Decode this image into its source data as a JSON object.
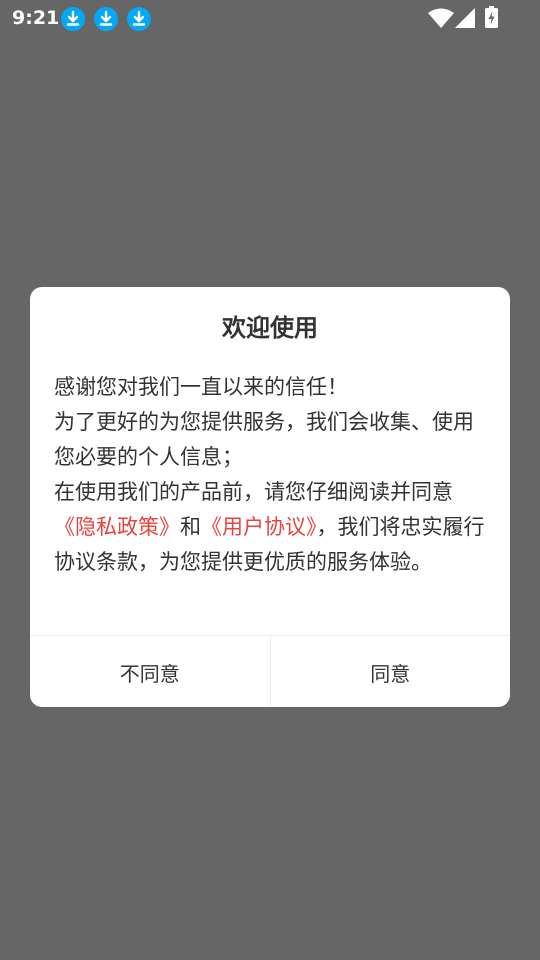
{
  "status_bar": {
    "time": "9:21",
    "download_icons": [
      "download-icon",
      "download-icon",
      "download-icon"
    ],
    "download_icon_color": "#03a9f4",
    "status_icons": [
      "wifi-icon",
      "cell-signal-icon",
      "battery-charging-icon"
    ]
  },
  "dialog": {
    "title": "欢迎使用",
    "body": {
      "line1": "感谢您对我们一直以来的信任！",
      "line2": "为了更好的为您提供服务，我们会收集、使用您必要的个人信息；",
      "line3_before": "在使用我们的产品前，请您仔细阅读并同意",
      "privacy_link": "《隐私政策》",
      "connector": "和",
      "user_agreement_link": "《用户协议》",
      "line3_after": "，我们将忠实履行协议条款，为您提供更优质的服务体验。"
    },
    "disagree_button": "不同意",
    "agree_button": "同意"
  },
  "colors": {
    "overlay_background": "#666666",
    "dialog_background": "#ffffff",
    "link_color": "#e8433e",
    "text_color": "#333333"
  }
}
